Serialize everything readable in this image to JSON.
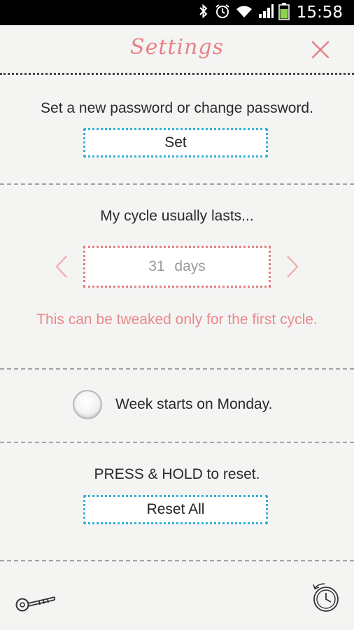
{
  "status_bar": {
    "time": "15:58",
    "icons": [
      "bluetooth-icon",
      "alarm-icon",
      "wifi-icon",
      "signal-icon",
      "battery-icon"
    ]
  },
  "header": {
    "title": "Settings",
    "close_icon": "close-icon"
  },
  "password": {
    "label": "Set a new password or change password.",
    "button_label": "Set"
  },
  "cycle": {
    "label": "My cycle usually lasts...",
    "value": "31",
    "unit": "days",
    "note": "This can be tweaked only for the first cycle."
  },
  "week": {
    "label": "Week starts on Monday.",
    "checked": false
  },
  "reset": {
    "label": "PRESS & HOLD to reset.",
    "button_label": "Reset All"
  },
  "footer": {
    "left_icon": "key-icon",
    "right_icon": "clock-history-icon"
  },
  "colors": {
    "accent_pink": "#e58285",
    "accent_blue": "#2fb2d8",
    "background": "#f4f4f3"
  }
}
